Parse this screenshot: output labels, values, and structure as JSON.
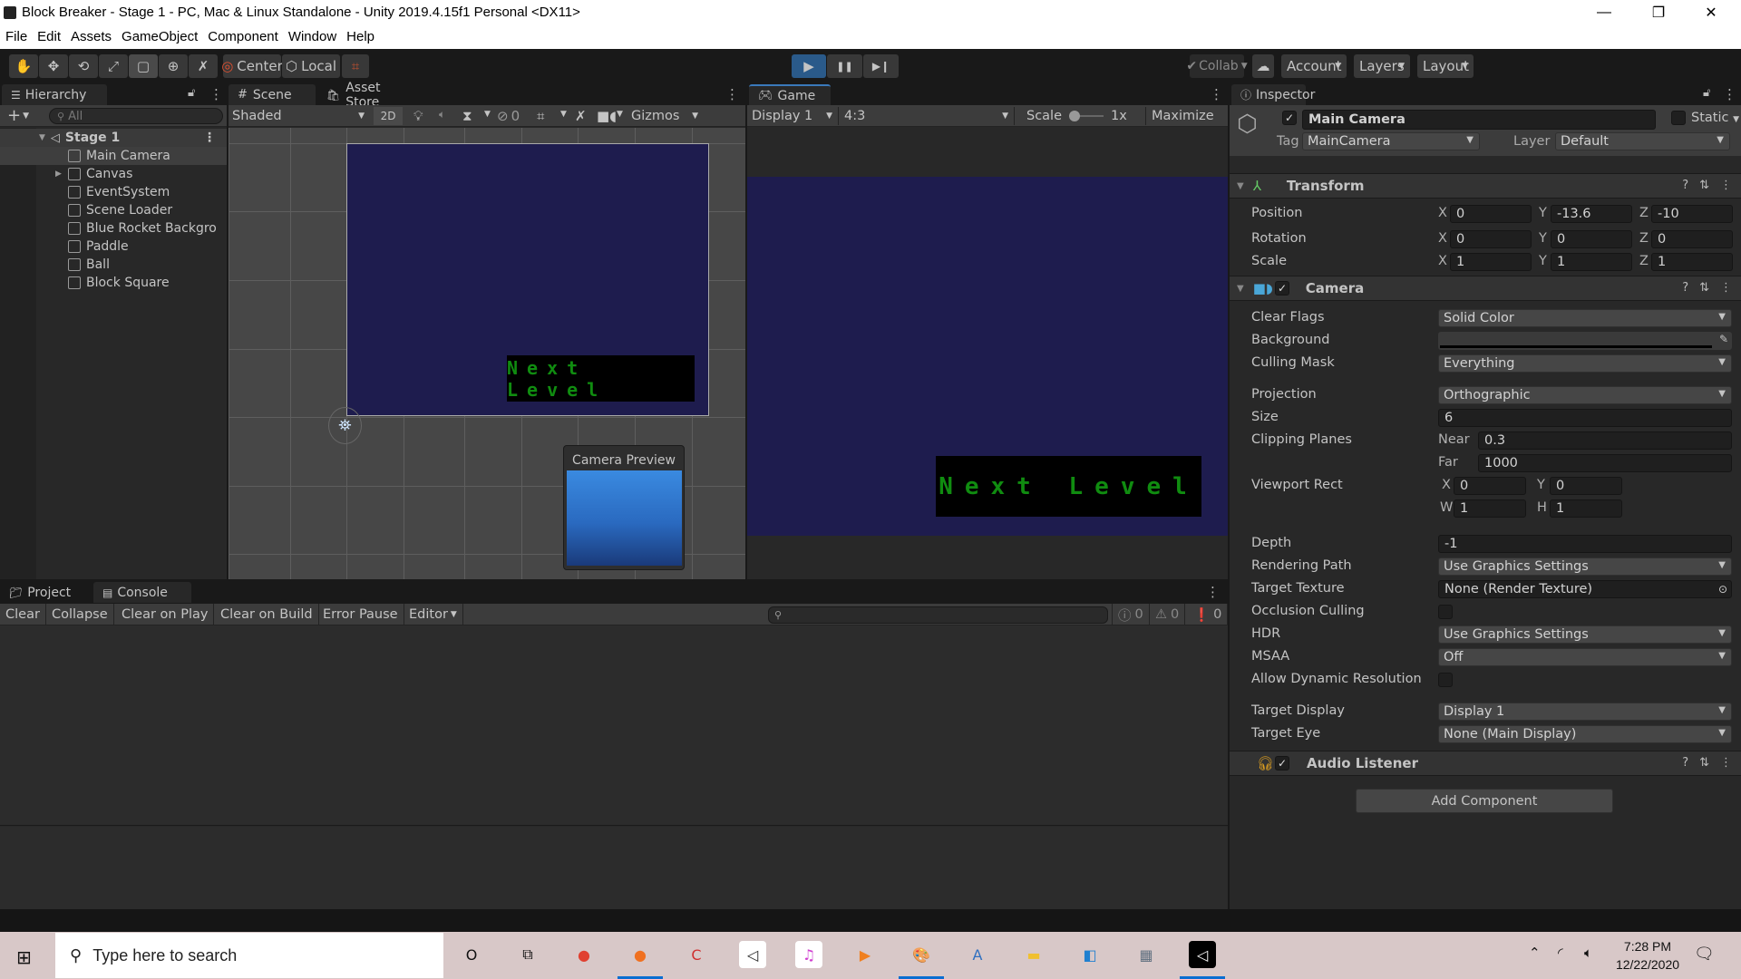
{
  "window": {
    "title": "Block Breaker - Stage 1 - PC, Mac & Linux Standalone - Unity 2019.4.15f1 Personal <DX11>",
    "controls": {
      "minimize": "—",
      "restore": "❐",
      "close": "✕"
    }
  },
  "menu": [
    "File",
    "Edit",
    "Assets",
    "GameObject",
    "Component",
    "Window",
    "Help"
  ],
  "toolbar": {
    "tools": [
      {
        "name": "hand-tool",
        "glyph": "✋"
      },
      {
        "name": "move-tool",
        "glyph": "✥"
      },
      {
        "name": "rotate-tool",
        "glyph": "⟲"
      },
      {
        "name": "scale-tool",
        "glyph": "⤢"
      },
      {
        "name": "rect-tool",
        "glyph": "▢"
      },
      {
        "name": "transform-tool",
        "glyph": "⊕"
      },
      {
        "name": "custom-tool",
        "glyph": "✗"
      }
    ],
    "pivot_mode": "Center",
    "pivot_rotation": "Local",
    "snap_icon": "⌗",
    "play": "▶",
    "pause": "❚❚",
    "step": "▶❙",
    "collab": "Collab",
    "account": "Account",
    "layers": "Layers",
    "layout": "Layout",
    "active_tool": "rect-tool",
    "playing": true
  },
  "hierarchy": {
    "tab": "Hierarchy",
    "search_placeholder": "All",
    "scene": "Stage 1",
    "items": [
      {
        "label": "Main Camera",
        "selected": true,
        "expandable": false
      },
      {
        "label": "Canvas",
        "selected": false,
        "expandable": true
      },
      {
        "label": "EventSystem",
        "selected": false,
        "expandable": false
      },
      {
        "label": "Scene Loader",
        "selected": false,
        "expandable": false
      },
      {
        "label": "Blue Rocket Backgro",
        "selected": false,
        "expandable": false
      },
      {
        "label": "Paddle",
        "selected": false,
        "expandable": false
      },
      {
        "label": "Ball",
        "selected": false,
        "expandable": false
      },
      {
        "label": "Block Square",
        "selected": false,
        "expandable": false
      }
    ]
  },
  "scene": {
    "tabs": [
      "Scene",
      "Asset Store"
    ],
    "shading": "Shaded",
    "mode_2d": "2D",
    "hidden_count": "0",
    "gizmos": "Gizmos",
    "button_text": "Next Level",
    "camera_preview_title": "Camera Preview",
    "bg_color": "#1e1c4e"
  },
  "game": {
    "tab": "Game",
    "display": "Display 1",
    "aspect": "4:3",
    "scale_label": "Scale",
    "scale_value": "1x",
    "scale_fraction": 0,
    "maximize": "Maximize",
    "button_text": "Next Level"
  },
  "inspector": {
    "tab": "Inspector",
    "object_name": "Main Camera",
    "active": true,
    "static_label": "Static",
    "tag_label": "Tag",
    "tag": "MainCamera",
    "layer_label": "Layer",
    "layer": "Default",
    "transform": {
      "title": "Transform",
      "rows": [
        {
          "label": "Position",
          "x": "0",
          "y": "-13.6",
          "z": "-10"
        },
        {
          "label": "Rotation",
          "x": "0",
          "y": "0",
          "z": "0"
        },
        {
          "label": "Scale",
          "x": "1",
          "y": "1",
          "z": "1"
        }
      ]
    },
    "camera": {
      "title": "Camera",
      "enabled": true,
      "clear_flags": {
        "label": "Clear Flags",
        "value": "Solid Color"
      },
      "background": {
        "label": "Background",
        "color": "#000000"
      },
      "culling_mask": {
        "label": "Culling Mask",
        "value": "Everything"
      },
      "projection": {
        "label": "Projection",
        "value": "Orthographic"
      },
      "size": {
        "label": "Size",
        "value": "6"
      },
      "clipping": {
        "label": "Clipping Planes",
        "near_label": "Near",
        "near": "0.3",
        "far_label": "Far",
        "far": "1000"
      },
      "viewport": {
        "label": "Viewport Rect",
        "x": "0",
        "y": "0",
        "w": "1",
        "h": "1"
      },
      "depth": {
        "label": "Depth",
        "value": "-1"
      },
      "rendering_path": {
        "label": "Rendering Path",
        "value": "Use Graphics Settings"
      },
      "target_texture": {
        "label": "Target Texture",
        "value": "None (Render Texture)"
      },
      "occlusion_culling": {
        "label": "Occlusion Culling",
        "checked": false
      },
      "hdr": {
        "label": "HDR",
        "value": "Use Graphics Settings"
      },
      "msaa": {
        "label": "MSAA",
        "value": "Off"
      },
      "dynamic_resolution": {
        "label": "Allow Dynamic Resolution",
        "checked": false
      },
      "target_display": {
        "label": "Target Display",
        "value": "Display 1"
      },
      "target_eye": {
        "label": "Target Eye",
        "value": "None (Main Display)"
      }
    },
    "audio_listener": {
      "title": "Audio Listener",
      "enabled": true
    },
    "add_component": "Add Component"
  },
  "console": {
    "tabs": [
      "Project",
      "Console"
    ],
    "buttons": [
      "Clear",
      "Collapse",
      "Clear on Play",
      "Clear on Build",
      "Error Pause",
      "Editor"
    ],
    "log_count": "0",
    "warning_count": "0",
    "error_count": "0"
  },
  "taskbar": {
    "search_placeholder": "Type here to search",
    "apps": [
      {
        "name": "cortana",
        "glyph": "O"
      },
      {
        "name": "task-view",
        "glyph": "⧉"
      },
      {
        "name": "chrome",
        "glyph": "●"
      },
      {
        "name": "firefox",
        "glyph": "●"
      },
      {
        "name": "ccleaner",
        "glyph": "C"
      },
      {
        "name": "unity-hub",
        "glyph": "◁"
      },
      {
        "name": "itunes",
        "glyph": "♫"
      },
      {
        "name": "media-player",
        "glyph": "▶"
      },
      {
        "name": "paint",
        "glyph": "🎨"
      },
      {
        "name": "wordpad",
        "glyph": "A"
      },
      {
        "name": "file-explorer",
        "glyph": "▬"
      },
      {
        "name": "control-panel",
        "glyph": "◧"
      },
      {
        "name": "calculator",
        "glyph": "▦"
      },
      {
        "name": "unity",
        "glyph": "◁"
      }
    ],
    "time": "7:28 PM",
    "date": "12/22/2020"
  }
}
